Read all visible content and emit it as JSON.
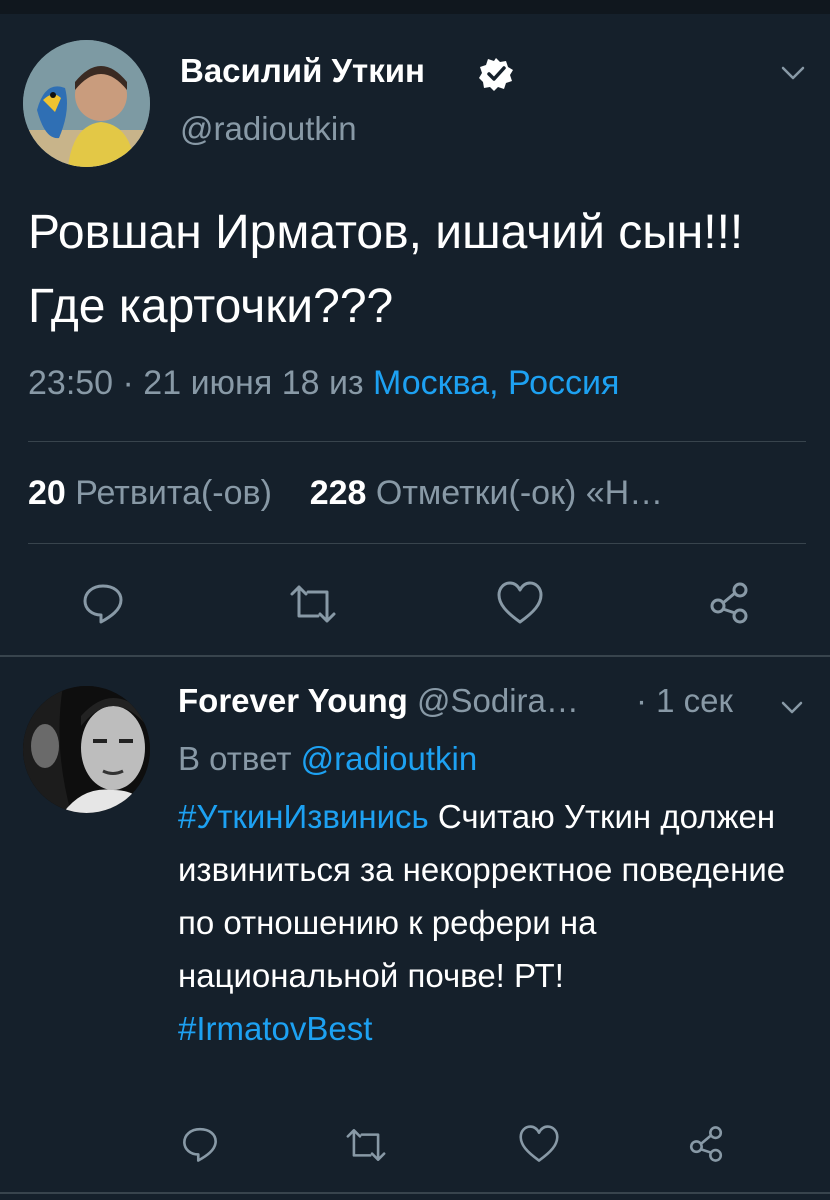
{
  "main_tweet": {
    "author_name": "Василий Уткин",
    "author_handle": "@radioutkin",
    "text": "Ровшан Ирматов, ишачий сын!!! Где карточки???",
    "time_date": "23:50 · 21 июня 18 из ",
    "location": "Москва, Россия",
    "retweet_count": "20",
    "retweet_label": "Ретвита(-ов)",
    "like_count": "228",
    "like_label": "Отметки(-ок) «Н…"
  },
  "reply_tweet": {
    "author_name": "Forever Young",
    "author_handle": "@Sodira…",
    "time": "· 1 сек",
    "reply_prefix": "В ответ",
    "reply_mention": "@radioutkin",
    "hashtag1": "#УткинИзвинись",
    "text": " Считаю Уткин должен извиниться за некорректное поведение по отношению к рефери на национальной почве! РТ!",
    "hashtag2": "#IrmatovBest"
  },
  "icons": {
    "verified": "verified-badge-icon",
    "chevron": "chevron-down-icon",
    "reply": "reply-icon",
    "retweet": "retweet-icon",
    "like": "heart-icon",
    "share": "share-icon"
  },
  "colors": {
    "background": "#15202b",
    "accent": "#1da1f2",
    "secondary_text": "#8899a6",
    "divider": "#38444d"
  }
}
